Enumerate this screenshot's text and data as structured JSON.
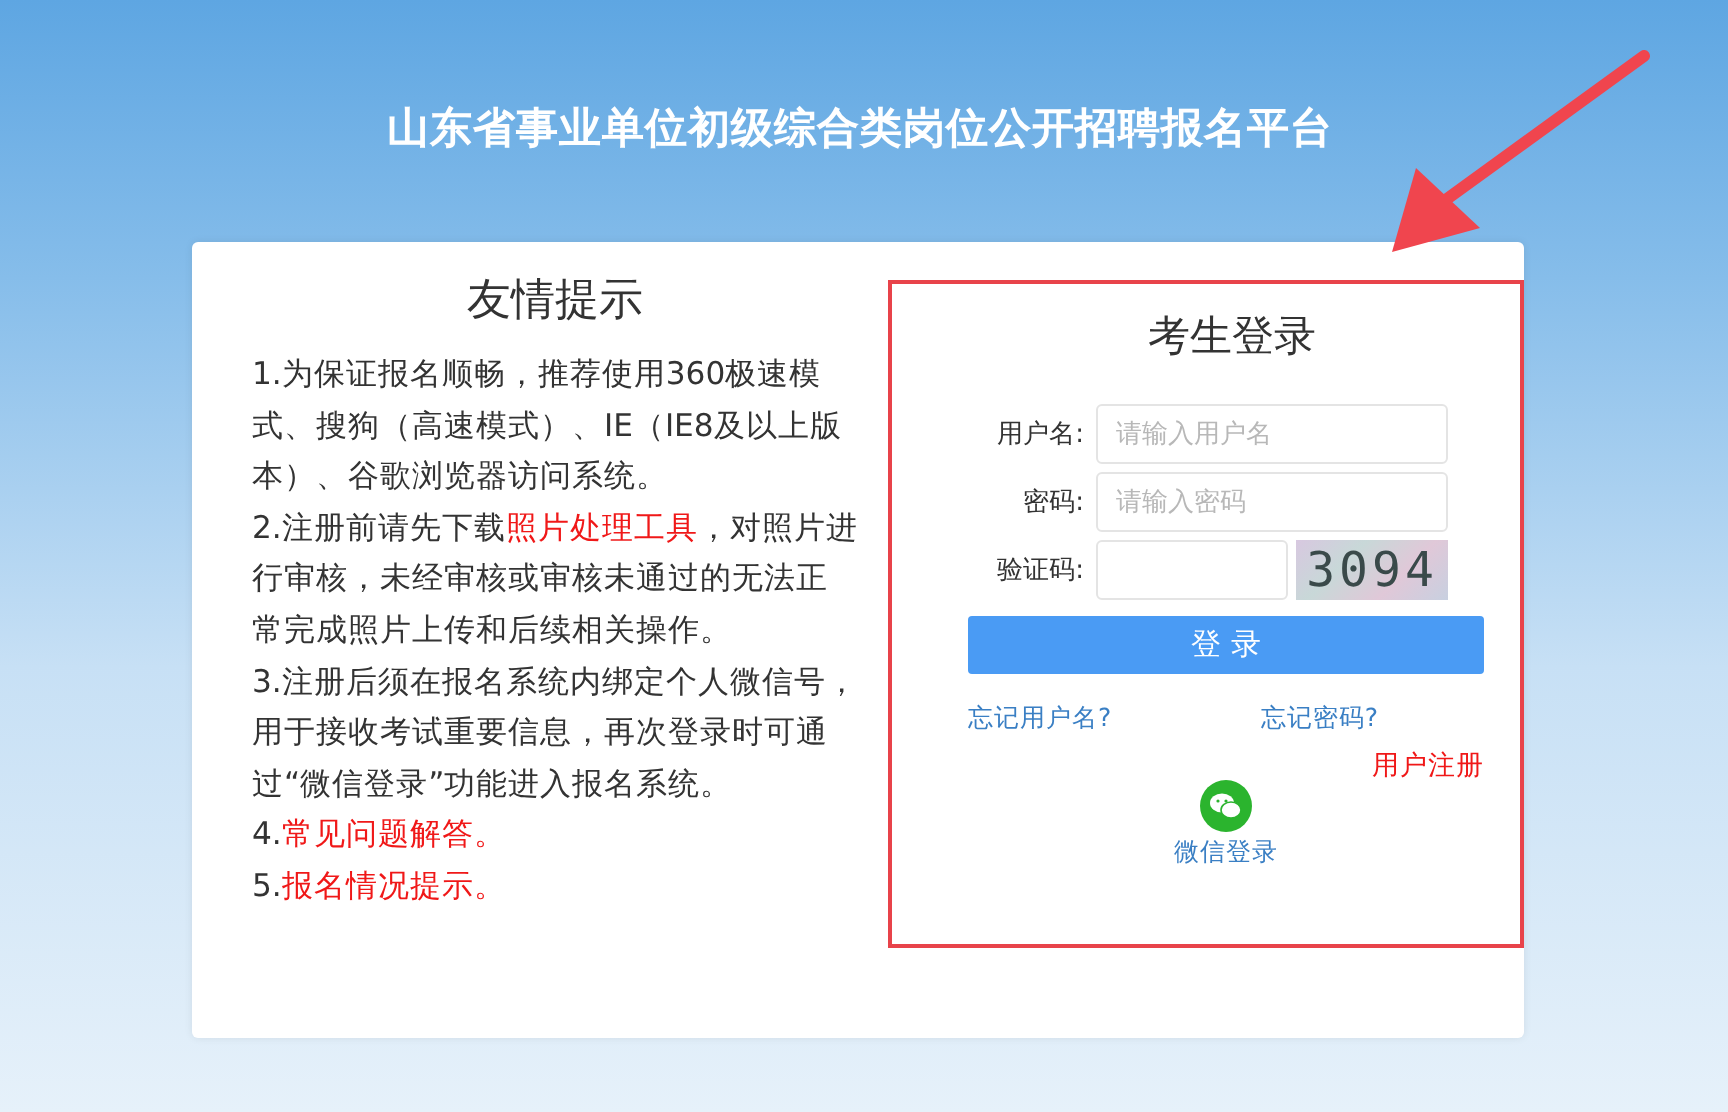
{
  "header": {
    "title": "山东省事业单位初级综合类岗位公开招聘报名平台"
  },
  "tips": {
    "title": "友情提示",
    "items": [
      {
        "parts": [
          {
            "kind": "text",
            "text": "1.为保证报名顺畅，推荐使用360极速模式、搜狗（高速模式）、IE（IE8及以上版本）、谷歌浏览器访问系统。"
          }
        ]
      },
      {
        "parts": [
          {
            "kind": "text",
            "text": "2.注册前请先下载"
          },
          {
            "kind": "link",
            "text": "照片处理工具"
          },
          {
            "kind": "text",
            "text": "，对照片进行审核，未经审核或审核未通过的无法正常完成照片上传和后续相关操作。"
          }
        ]
      },
      {
        "parts": [
          {
            "kind": "text",
            "text": "3.注册后须在报名系统内绑定个人微信号，用于接收考试重要信息，再次登录时可通过“微信登录”功能进入报名系统。"
          }
        ]
      },
      {
        "parts": [
          {
            "kind": "text",
            "text": "4."
          },
          {
            "kind": "link",
            "text": "常见问题解答。"
          }
        ]
      },
      {
        "parts": [
          {
            "kind": "text",
            "text": "5."
          },
          {
            "kind": "link",
            "text": "报名情况提示。"
          }
        ]
      }
    ]
  },
  "login": {
    "title": "考生登录",
    "fields": [
      {
        "kind": "text",
        "label": "用户名:",
        "placeholder": "请输入用户名"
      },
      {
        "kind": "password",
        "label": "密码:",
        "placeholder": "请输入密码"
      },
      {
        "kind": "captcha",
        "label": "验证码:",
        "captcha": "3094"
      }
    ],
    "submit": "登 录",
    "forgot_username": "忘记用户名?",
    "forgot_password": "忘记密码?",
    "register": "用户注册",
    "wechat_login": "微信登录"
  }
}
